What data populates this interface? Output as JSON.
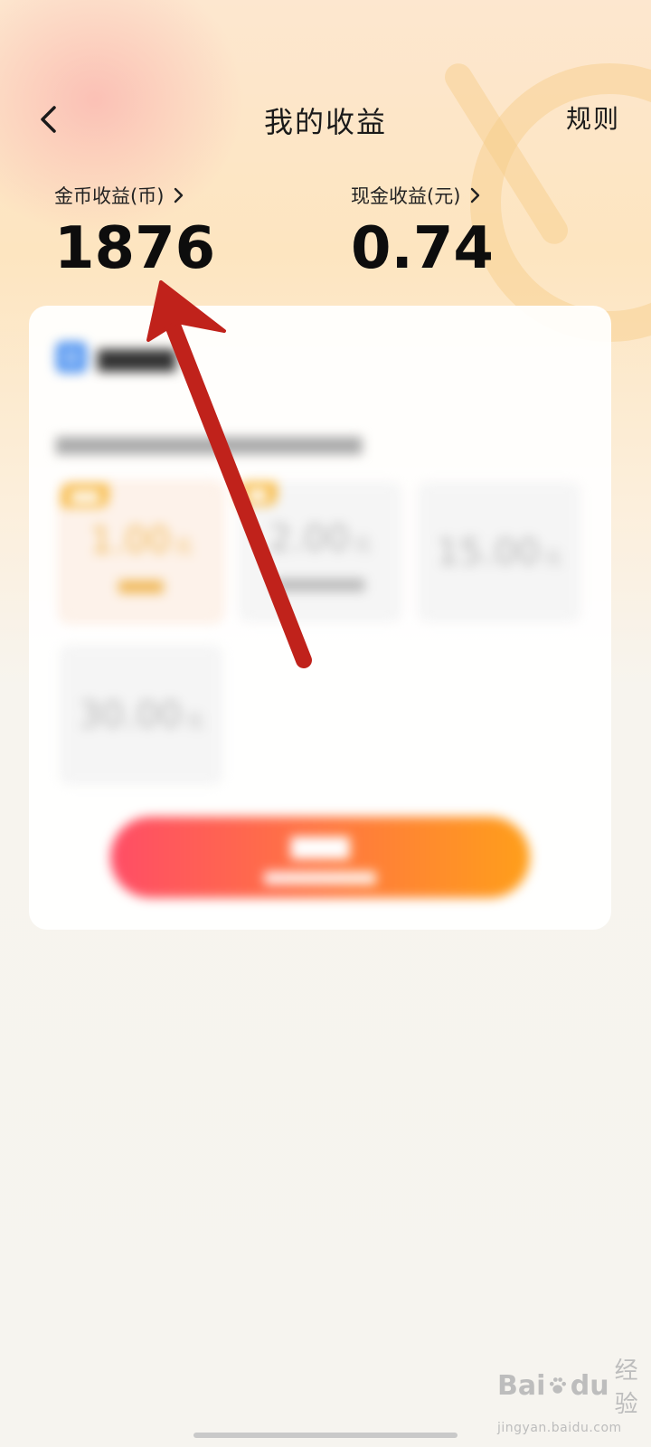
{
  "header": {
    "title": "我的收益",
    "rules_label": "规则"
  },
  "stats": {
    "coin": {
      "label": "金币收益(币)",
      "value": "1876"
    },
    "cash": {
      "label": "现金收益(元)",
      "value": "0.74"
    }
  },
  "withdraw_card": {
    "tiles": [
      {
        "amount": "1.00",
        "unit": "元"
      },
      {
        "amount": "2.00",
        "unit": "元"
      },
      {
        "amount": "15.00",
        "unit": "元"
      },
      {
        "amount": "30.00",
        "unit": "元"
      }
    ]
  },
  "colors": {
    "annotation_arrow": "#c0221b",
    "cta_start": "#ff4d66",
    "cta_end": "#ff9f1a"
  },
  "watermark": {
    "brand_left": "Bai",
    "brand_right": "du",
    "brand_zh": "经验",
    "url": "jingyan.baidu.com"
  },
  "icons": {
    "back": "chevron-left-icon",
    "stat_more": "chevron-right-icon",
    "pay": "payment-icon",
    "annotation": "red-arrow-icon"
  }
}
